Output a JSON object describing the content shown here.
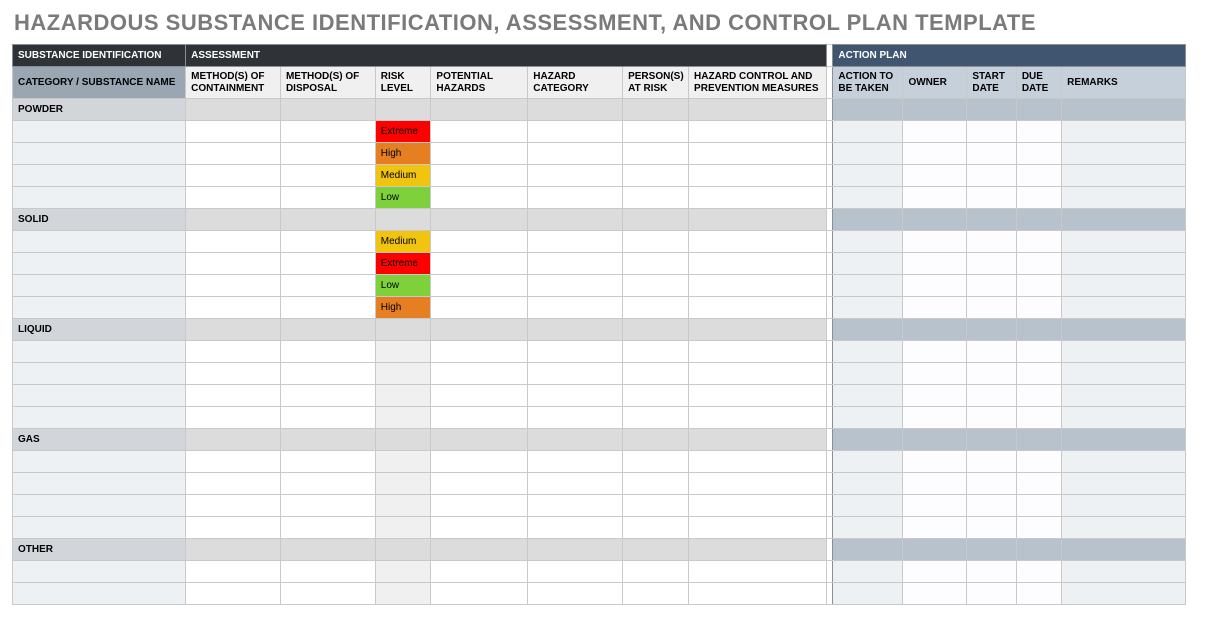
{
  "title": "HAZARDOUS SUBSTANCE IDENTIFICATION, ASSESSMENT, AND CONTROL PLAN TEMPLATE",
  "sections": {
    "identification": "SUBSTANCE IDENTIFICATION",
    "assessment": "ASSESSMENT",
    "action": "ACTION PLAN"
  },
  "columns": {
    "name": "CATEGORY / SUBSTANCE NAME",
    "containment": "METHOD(S) OF CONTAINMENT",
    "disposal": "METHOD(S) OF DISPOSAL",
    "risk": "RISK LEVEL",
    "potential": "POTENTIAL HAZARDS",
    "hazcat": "HAZARD CATEGORY",
    "persons": "PERSON(S) AT RISK",
    "control": "HAZARD CONTROL AND PREVENTION MEASURES",
    "action": "ACTION TO BE TAKEN",
    "owner": "OWNER",
    "start": "START DATE",
    "due": "DUE DATE",
    "remarks": "REMARKS"
  },
  "categories": [
    {
      "label": "POWDER",
      "rows": [
        {
          "risk": "Extreme",
          "risk_class": "risk-extreme"
        },
        {
          "risk": "High",
          "risk_class": "risk-high"
        },
        {
          "risk": "Medium",
          "risk_class": "risk-medium"
        },
        {
          "risk": "Low",
          "risk_class": "risk-low"
        }
      ]
    },
    {
      "label": "SOLID",
      "rows": [
        {
          "risk": "Medium",
          "risk_class": "risk-medium"
        },
        {
          "risk": "Extreme",
          "risk_class": "risk-extreme"
        },
        {
          "risk": "Low",
          "risk_class": "risk-low"
        },
        {
          "risk": "High",
          "risk_class": "risk-high"
        }
      ]
    },
    {
      "label": "LIQUID",
      "rows": [
        {
          "risk": "",
          "risk_class": ""
        },
        {
          "risk": "",
          "risk_class": ""
        },
        {
          "risk": "",
          "risk_class": ""
        },
        {
          "risk": "",
          "risk_class": ""
        }
      ]
    },
    {
      "label": "GAS",
      "rows": [
        {
          "risk": "",
          "risk_class": ""
        },
        {
          "risk": "",
          "risk_class": ""
        },
        {
          "risk": "",
          "risk_class": ""
        },
        {
          "risk": "",
          "risk_class": ""
        }
      ]
    },
    {
      "label": "OTHER",
      "rows": [
        {
          "risk": "",
          "risk_class": ""
        },
        {
          "risk": "",
          "risk_class": ""
        }
      ]
    }
  ]
}
